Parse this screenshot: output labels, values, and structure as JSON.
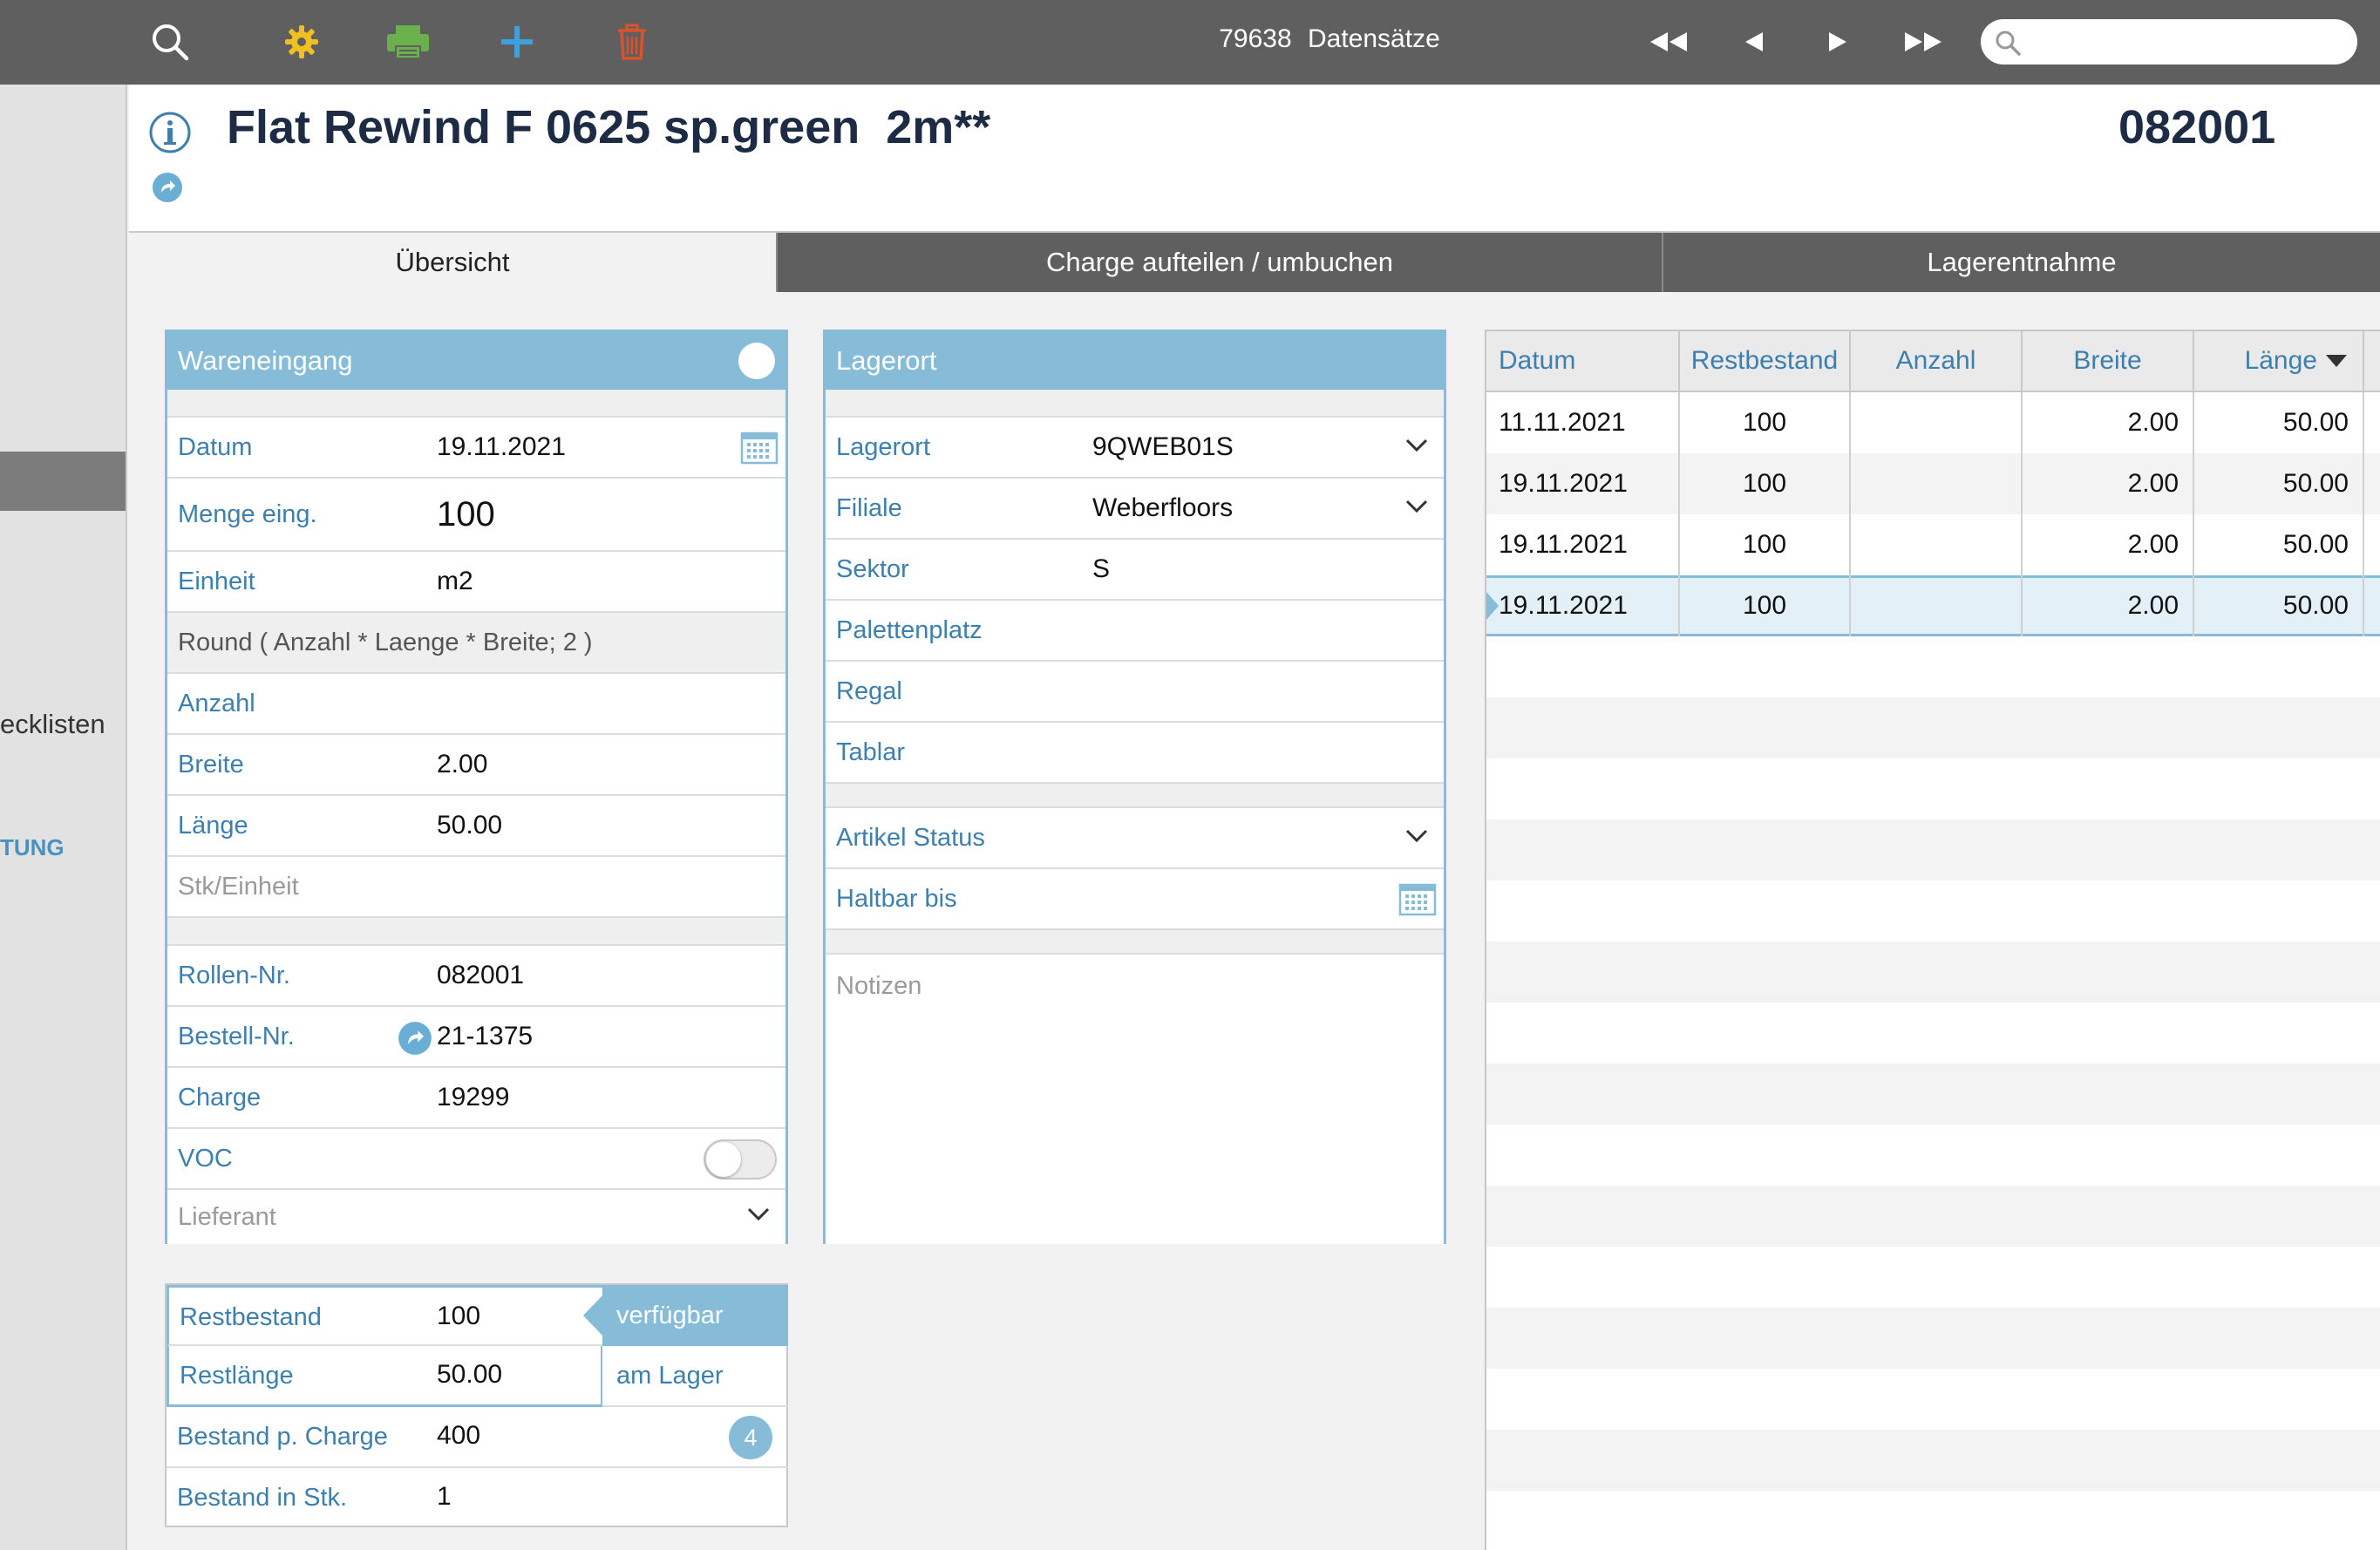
{
  "toolbar": {
    "record_count": "79638",
    "records_label": "Datensätze",
    "search_value": "",
    "colors": {
      "gear": "#f0c020",
      "print": "#6ab04c",
      "add": "#3fa0e0",
      "delete": "#d9542b"
    }
  },
  "sidebar": {
    "text1": "ecklisten",
    "text2": "TUNG"
  },
  "header": {
    "title": "Flat Rewind F 0625 sp.green  2m**",
    "record_no": "082001"
  },
  "tabs": [
    {
      "label": "Übersicht",
      "active": true
    },
    {
      "label": "Charge aufteilen / umbuchen",
      "active": false
    },
    {
      "label": "Lagerentnahme",
      "active": false
    }
  ],
  "wareneingang": {
    "title": "Wareneingang",
    "datum_label": "Datum",
    "datum_value": "19.11.2021",
    "menge_label": "Menge eing.",
    "menge_value": "100",
    "einheit_label": "Einheit",
    "einheit_value": "m2",
    "formula": "Round ( Anzahl * Laenge * Breite; 2 )",
    "anzahl_label": "Anzahl",
    "anzahl_value": "",
    "breite_label": "Breite",
    "breite_value": "2.00",
    "laenge_label": "Länge",
    "laenge_value": "50.00",
    "stk_label": "Stk/Einheit",
    "rollen_label": "Rollen-Nr.",
    "rollen_value": "082001",
    "bestell_label": "Bestell-Nr.",
    "bestell_value": "21-1375",
    "charge_label": "Charge",
    "charge_value": "19299",
    "voc_label": "VOC",
    "voc_on": false,
    "lieferant_label": "Lieferant"
  },
  "lagerort": {
    "title": "Lagerort",
    "lagerort_label": "Lagerort",
    "lagerort_value": "9QWEB01S",
    "filiale_label": "Filiale",
    "filiale_value": "Weberfloors",
    "sektor_label": "Sektor",
    "sektor_value": "S",
    "palettenplatz_label": "Palettenplatz",
    "regal_label": "Regal",
    "tablar_label": "Tablar",
    "status_label": "Artikel Status",
    "haltbar_label": "Haltbar bis",
    "notes_placeholder": "Notizen"
  },
  "stock": {
    "restbestand_label": "Restbestand",
    "restbestand_value": "100",
    "status_badge": "verfügbar",
    "restlaenge_label": "Restlänge",
    "restlaenge_value": "50.00",
    "location_status": "am Lager",
    "bestand_charge_label": "Bestand p. Charge",
    "bestand_charge_value": "400",
    "charge_count": "4",
    "bestand_stk_label": "Bestand in Stk.",
    "bestand_stk_value": "1"
  },
  "table": {
    "columns": [
      "Datum",
      "Restbestand",
      "Anzahl",
      "Breite",
      "Länge"
    ],
    "rows": [
      {
        "datum": "11.11.2021",
        "rest": "100",
        "anzahl": "",
        "breite": "2.00",
        "laenge": "50.00"
      },
      {
        "datum": "19.11.2021",
        "rest": "100",
        "anzahl": "",
        "breite": "2.00",
        "laenge": "50.00"
      },
      {
        "datum": "19.11.2021",
        "rest": "100",
        "anzahl": "",
        "breite": "2.00",
        "laenge": "50.00"
      },
      {
        "datum": "19.11.2021",
        "rest": "100",
        "anzahl": "",
        "breite": "2.00",
        "laenge": "50.00",
        "selected": true
      }
    ]
  }
}
